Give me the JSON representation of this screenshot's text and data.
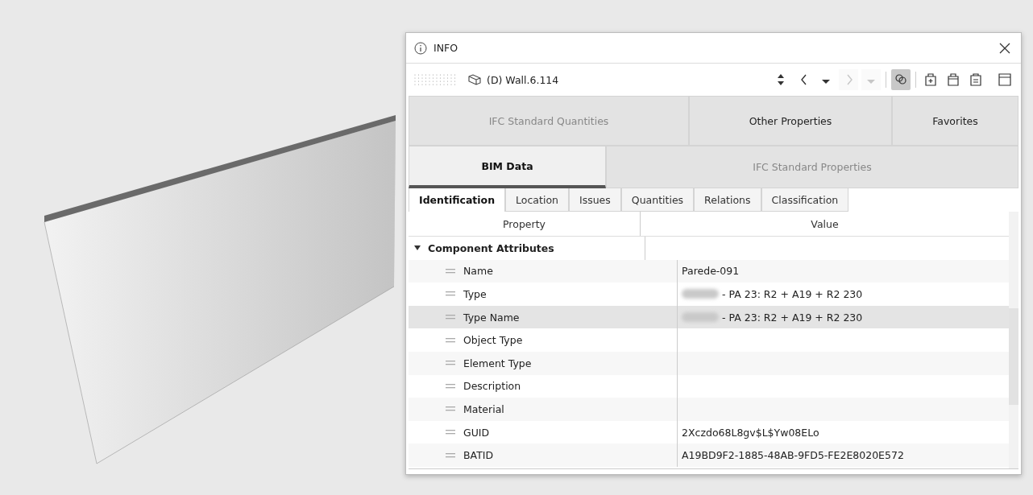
{
  "viewport": {
    "kind": "picture"
  },
  "window": {
    "title": "INFO"
  },
  "toolbar": {
    "object": "(D) Wall.6.114",
    "tools": [
      {
        "kind": "sort",
        "disabled": false,
        "on": false
      },
      {
        "kind": "prev",
        "disabled": false,
        "on": false
      },
      {
        "kind": "drop",
        "disabled": false,
        "on": false
      },
      {
        "kind": "next",
        "disabled": true,
        "on": false
      },
      {
        "kind": "drop",
        "disabled": true,
        "on": false
      },
      {
        "kind": "link",
        "disabled": false,
        "on": true
      },
      {
        "kind": "add",
        "disabled": false,
        "on": false
      },
      {
        "kind": "bag",
        "disabled": false,
        "on": false
      },
      {
        "kind": "list",
        "disabled": false,
        "on": false
      },
      {
        "kind": "panel",
        "disabled": false,
        "on": false
      }
    ]
  },
  "tab_rows": [
    [
      {
        "label": "IFC Standard Quantities",
        "selected": false
      },
      {
        "label": "Other Properties",
        "selected": false
      },
      {
        "label": "Favorites",
        "selected": false
      }
    ],
    [
      {
        "label": "BIM Data",
        "selected": true
      },
      {
        "label": "IFC Standard Properties",
        "selected": false
      }
    ]
  ],
  "sub_tabs": [
    {
      "label": "Identification",
      "selected": true
    },
    {
      "label": "Location",
      "selected": false
    },
    {
      "label": "Issues",
      "selected": false
    },
    {
      "label": "Quantities",
      "selected": false
    },
    {
      "label": "Relations",
      "selected": false
    },
    {
      "label": "Classification",
      "selected": false
    }
  ],
  "table": {
    "columns": [
      "Property",
      "Value"
    ],
    "groups": [
      {
        "label": "Component Attributes",
        "expanded": true,
        "children": [
          {
            "property": "Name",
            "value": "Parede-091",
            "selected": false
          },
          {
            "property": "Type",
            "value": "- PA 23: R2 + A19 + R2 230",
            "redacted": true,
            "selected": false
          },
          {
            "property": "Type Name",
            "value": "- PA 23: R2 + A19 + R2 230",
            "redacted": true,
            "selected": true
          },
          {
            "property": "Object Type",
            "selected": false
          },
          {
            "property": "Element Type",
            "selected": false
          },
          {
            "property": "Description",
            "selected": false
          },
          {
            "property": "Material",
            "selected": false
          },
          {
            "property": "GUID",
            "value": "2Xczdo68L8gv$L$Yw08ELo",
            "selected": false
          },
          {
            "property": "BATID",
            "value": "A19BD9F2-1885-48AB-9FD5-FE2E8020E572",
            "selected": false
          }
        ]
      }
    ]
  }
}
